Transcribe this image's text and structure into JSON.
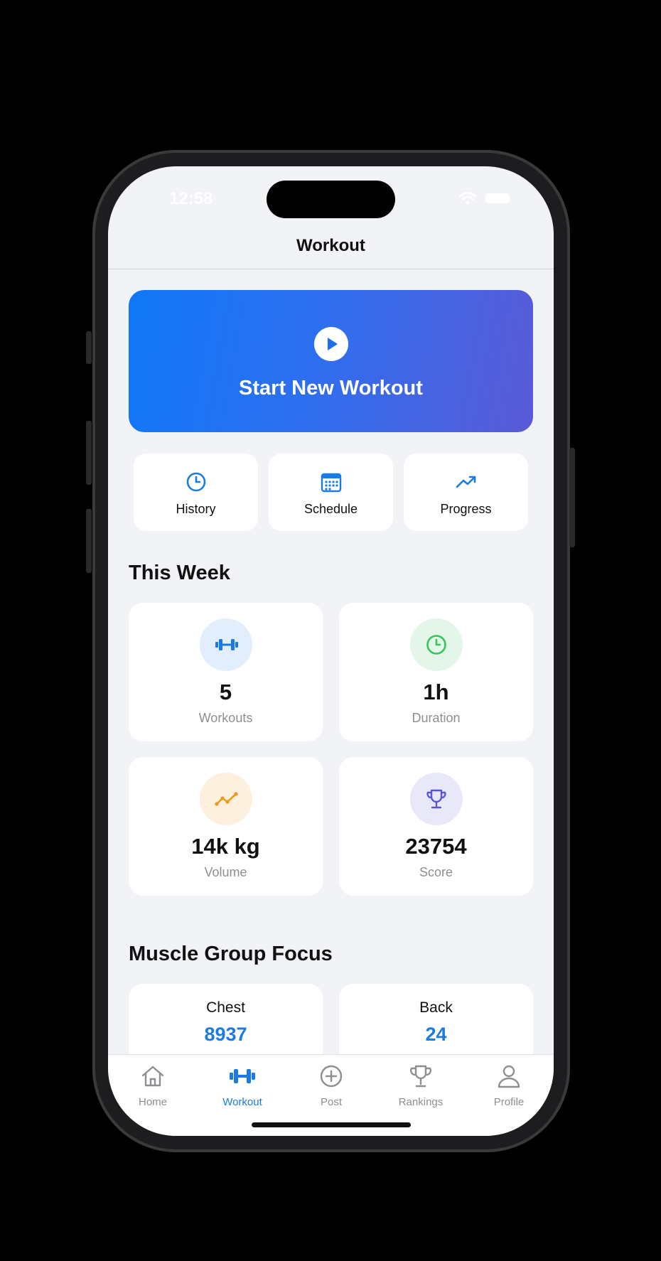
{
  "status": {
    "time": "12:58"
  },
  "nav": {
    "title": "Workout"
  },
  "hero": {
    "label": "Start New Workout"
  },
  "quick_actions": [
    {
      "label": "History",
      "icon": "clock-icon"
    },
    {
      "label": "Schedule",
      "icon": "calendar-icon"
    },
    {
      "label": "Progress",
      "icon": "trending-up-icon"
    }
  ],
  "this_week": {
    "title": "This Week",
    "stats": [
      {
        "value": "5",
        "label": "Workouts",
        "icon": "dumbbell-icon",
        "color": "#1a7be6",
        "bg": "#e3eefc"
      },
      {
        "value": "1h",
        "label": "Duration",
        "icon": "clock-icon",
        "color": "#34c759",
        "bg": "#e4f6e9"
      },
      {
        "value": "14k kg",
        "label": "Volume",
        "icon": "trend-line-icon",
        "color": "#f19a1a",
        "bg": "#fdf0de"
      },
      {
        "value": "23754",
        "label": "Score",
        "icon": "trophy-icon",
        "color": "#5b55d6",
        "bg": "#e9e8f8"
      }
    ]
  },
  "muscle_focus": {
    "title": "Muscle Group Focus",
    "items": [
      {
        "name": "Chest",
        "value": "8937"
      },
      {
        "name": "Back",
        "value": "24"
      }
    ]
  },
  "tabs": [
    {
      "label": "Home",
      "icon": "house-icon"
    },
    {
      "label": "Workout",
      "icon": "dumbbell-icon",
      "active": true
    },
    {
      "label": "Post",
      "icon": "plus-circle-icon"
    },
    {
      "label": "Rankings",
      "icon": "trophy-icon"
    },
    {
      "label": "Profile",
      "icon": "person-icon"
    }
  ],
  "colors": {
    "accent": "#1a7be6",
    "gradient_start": "#0f78f7",
    "gradient_end": "#5a5ad6"
  }
}
